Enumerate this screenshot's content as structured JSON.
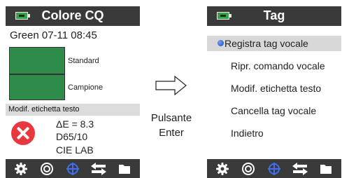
{
  "left_screen": {
    "title": "Colore CQ",
    "sample_line": "Green 07-11 08:45",
    "standard_label": "Standard",
    "sample_label": "Campione",
    "mod_label": "Modif. etichetta testo",
    "delta_e": "ΔE = 8.3",
    "illuminant": "D65/10",
    "color_space": "CIE LAB",
    "swatch_color": "#2e8b48",
    "status_icon": "fail-x-icon"
  },
  "right_screen": {
    "title": "Tag",
    "menu_items": [
      "Registra tag vocale",
      "Ripr. comando vocale",
      "Modif. etichetta testo",
      "Cancella tag vocale",
      "Indietro"
    ],
    "selected_index": 0
  },
  "transition": {
    "line1": "Pulsante",
    "line2": "Enter"
  },
  "toolbar_icons": [
    "gear-icon",
    "target-icon",
    "crosshair-icon",
    "swap-arrows-icon",
    "folder-icon"
  ],
  "colors": {
    "titlebar": "#3a3a3a",
    "swatch_green": "#2e8b48",
    "fail_red": "#e8383d",
    "selected_bullet": "#1a47b8",
    "crosshair_blue": "#3f6df0"
  }
}
